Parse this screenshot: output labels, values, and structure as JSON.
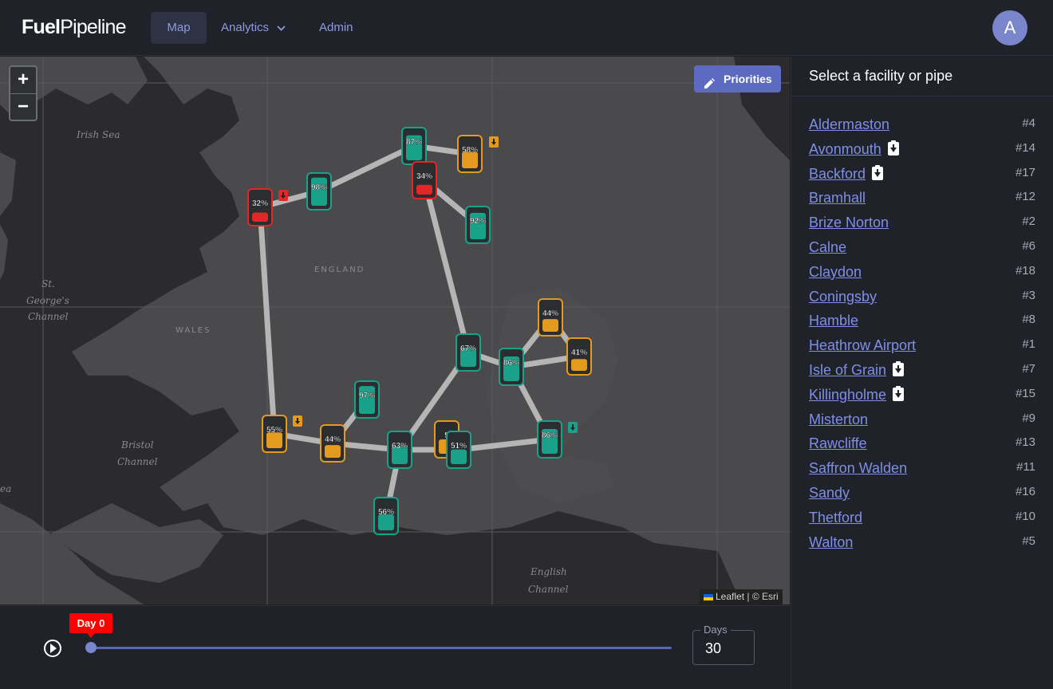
{
  "brand": {
    "bold": "Fuel",
    "light": "Pipeline"
  },
  "nav": {
    "map": "Map",
    "analytics": "Analytics",
    "admin": "Admin"
  },
  "user": {
    "avatar_initial": "A"
  },
  "map": {
    "zoom_in": "+",
    "zoom_out": "−",
    "priorities_label": "Priorities",
    "labels": {
      "irish_sea": "Irish Sea",
      "england": "ENGLAND",
      "wales": "WALES",
      "st_georges_1": "St.",
      "st_georges_2": "George's",
      "st_georges_3": "Channel",
      "bristol_1": "Bristol",
      "bristol_2": "Channel",
      "english_1": "English",
      "english_2": "Channel",
      "sea_edge": "ea",
      "england_2": "EN     ND"
    },
    "attribution": {
      "leaflet": "Leaflet",
      "sep": " | © ",
      "esri": "Esri"
    },
    "tanks": [
      {
        "label": "87%",
        "level": 0.87,
        "status": "good",
        "color": "#1aa18a"
      },
      {
        "label": "58%",
        "level": 0.58,
        "status": "warn",
        "color": "#e39a1e"
      },
      {
        "label": "34%",
        "level": 0.34,
        "status": "bad",
        "color": "#e32626"
      },
      {
        "label": "98%",
        "level": 0.98,
        "status": "good",
        "color": "#1aa18a"
      },
      {
        "label": "32%",
        "level": 0.32,
        "status": "bad",
        "color": "#e32626"
      },
      {
        "label": "92%",
        "level": 0.92,
        "status": "good",
        "color": "#1aa18a"
      },
      {
        "label": "44%",
        "level": 0.44,
        "status": "warn",
        "color": "#e39a1e"
      },
      {
        "label": "41%",
        "level": 0.41,
        "status": "warn",
        "color": "#e39a1e"
      },
      {
        "label": "67%",
        "level": 0.67,
        "status": "good",
        "color": "#1aa18a"
      },
      {
        "label": "86%",
        "level": 0.86,
        "status": "good",
        "color": "#1aa18a"
      },
      {
        "label": "97%",
        "level": 0.97,
        "status": "good",
        "color": "#1aa18a"
      },
      {
        "label": "55%",
        "level": 0.55,
        "status": "warn",
        "color": "#e39a1e"
      },
      {
        "label": "44%",
        "level": 0.44,
        "status": "warn",
        "color": "#e39a1e"
      },
      {
        "label": "63%",
        "level": 0.63,
        "status": "good",
        "color": "#1aa18a"
      },
      {
        "label": "5",
        "level": 0.5,
        "status": "warn",
        "color": "#e39a1e"
      },
      {
        "label": "51%",
        "level": 0.51,
        "status": "good",
        "color": "#1aa18a"
      },
      {
        "label": "86%",
        "level": 0.86,
        "status": "good",
        "color": "#1aa18a"
      },
      {
        "label": "56%",
        "level": 0.56,
        "status": "good",
        "color": "#1aa18a"
      }
    ]
  },
  "timeline": {
    "day_badge": "Day 0",
    "days_label": "Days",
    "days_value": "30",
    "position": 0
  },
  "sidebar": {
    "title": "Select a facility or pipe",
    "facilities": [
      {
        "name": "Aldermaston",
        "num": "#4",
        "clip": false
      },
      {
        "name": "Avonmouth",
        "num": "#14",
        "clip": true
      },
      {
        "name": "Backford",
        "num": "#17",
        "clip": true
      },
      {
        "name": "Bramhall",
        "num": "#12",
        "clip": false
      },
      {
        "name": "Brize Norton",
        "num": "#2",
        "clip": false
      },
      {
        "name": "Calne",
        "num": "#6",
        "clip": false
      },
      {
        "name": "Claydon",
        "num": "#18",
        "clip": false
      },
      {
        "name": "Coningsby",
        "num": "#3",
        "clip": false
      },
      {
        "name": "Hamble",
        "num": "#8",
        "clip": false
      },
      {
        "name": "Heathrow Airport",
        "num": "#1",
        "clip": false
      },
      {
        "name": "Isle of Grain",
        "num": "#7",
        "clip": true
      },
      {
        "name": "Killingholme",
        "num": "#15",
        "clip": true
      },
      {
        "name": "Misterton",
        "num": "#9",
        "clip": false
      },
      {
        "name": "Rawcliffe",
        "num": "#13",
        "clip": false
      },
      {
        "name": "Saffron Walden",
        "num": "#11",
        "clip": false
      },
      {
        "name": "Sandy",
        "num": "#16",
        "clip": false
      },
      {
        "name": "Thetford",
        "num": "#10",
        "clip": false
      },
      {
        "name": "Walton",
        "num": "#5",
        "clip": false
      }
    ]
  },
  "colors": {
    "accent": "#7986cb",
    "good": "#1aa18a",
    "warn": "#e39a1e",
    "bad": "#e32626"
  }
}
